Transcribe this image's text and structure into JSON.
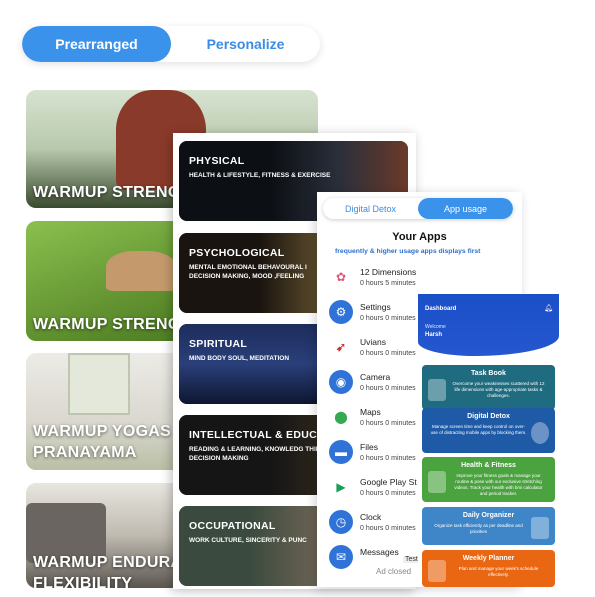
{
  "toggle": {
    "left": "Prearranged",
    "right": "Personalize"
  },
  "warmup_cards": [
    {
      "line1": "WARMUP STRENG",
      "line2": ""
    },
    {
      "line1": "WARMUP STRENG",
      "line2": ""
    },
    {
      "line1": "WARMUP YOGAS",
      "line2": "PRANAYAMA"
    },
    {
      "line1": "WARMUP ENDURA",
      "line2": "FLEXIBILITY"
    }
  ],
  "dimension_cards": [
    {
      "title": "PHYSICAL",
      "desc": "HEALTH & LIFESTYLE, FITNESS & EXERCISE"
    },
    {
      "title": "PSYCHOLOGICAL",
      "desc": "MENTAL EMOTIONAL BEHAVOURAL I DECISION MAKING, MOOD ,FEELING"
    },
    {
      "title": "SPIRITUAL",
      "desc": "MIND BODY SOUL, MEDITATION"
    },
    {
      "title": "INTELLECTUAL & EDUCAT",
      "desc": "READING & LEARNING, KNOWLEDG THINK, DECISION MAKING"
    },
    {
      "title": "OCCUPATIONAL",
      "desc": "WORK CULTURE, SINCERITY & PUNC"
    }
  ],
  "apps_screen": {
    "toggle": {
      "left": "Digital Detox",
      "right": "App usage"
    },
    "title": "Your Apps",
    "subtitle": "frequently & higher usage apps displays first",
    "apps": [
      {
        "name": "12 Dimensions",
        "time": "0 hours 5 minutes",
        "icon": "flower-icon",
        "color": "#ffffff"
      },
      {
        "name": "Settings",
        "time": "0 hours 0 minutes",
        "icon": "gear-icon",
        "color": "#2f73d9"
      },
      {
        "name": "Uvians",
        "time": "0 hours 0 minutes",
        "icon": "uvians-logo-icon",
        "color": "#ffffff"
      },
      {
        "name": "Camera",
        "time": "0 hours 0 minutes",
        "icon": "camera-icon",
        "color": "#2f73d9"
      },
      {
        "name": "Maps",
        "time": "0 hours 0 minutes",
        "icon": "map-pin-icon",
        "color": "#ffffff"
      },
      {
        "name": "Files",
        "time": "0 hours 0 minutes",
        "icon": "folder-icon",
        "color": "#2f73d9"
      },
      {
        "name": "Google Play St",
        "time": "0 hours 0 minutes",
        "icon": "play-store-icon",
        "color": "#ffffff"
      },
      {
        "name": "Clock",
        "time": "0 hours 0 minutes",
        "icon": "clock-icon",
        "color": "#2f73d9"
      },
      {
        "name": "Messages",
        "time": "",
        "icon": "message-icon",
        "color": "#2f73d9"
      }
    ],
    "ad_tag": "Test",
    "ad_text": "Ad closed"
  },
  "dashboard": {
    "title": "Dashboard",
    "welcome": "Welcome",
    "user": "Harsh",
    "tiles": [
      {
        "title": "Task Book",
        "desc": "Overcome your weaknesses scattered with 12 life dimensions with age-appropriate tasks & challenges."
      },
      {
        "title": "Digital Detox",
        "desc": "Manage screen time and keep control on over-use of distracting mobile apps by blocking them."
      },
      {
        "title": "Health & Fitness",
        "desc": "Improve your fitness goals & manage your routine & pose with our exclusive stretching videos. Track your health with bmi calculator and period tracker."
      },
      {
        "title": "Daily Organizer",
        "desc": "Organize task efficiently as per deadline and priorities"
      },
      {
        "title": "Weekly Planner",
        "desc": "Plan and manage your week's schedule effectively."
      }
    ]
  }
}
